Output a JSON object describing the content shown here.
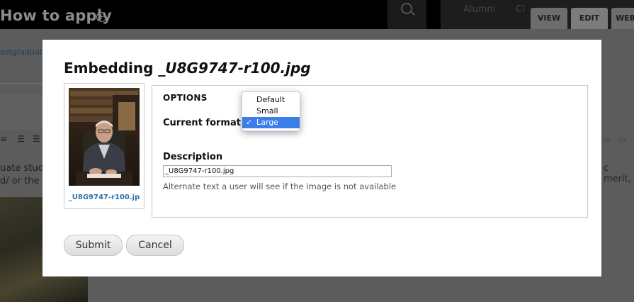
{
  "background": {
    "page_title": "How to apply",
    "nav": {
      "alumni": "Alumni",
      "more": "Cl"
    },
    "tabs": {
      "view": "VIEW",
      "edit": "EDIT",
      "web": "WEB"
    },
    "breadcrumb_link": "ostgraduate",
    "body_text_line1": "uate study",
    "body_text_line2": "d/ or the a",
    "body_text_right": "c merit,"
  },
  "dialog": {
    "title_prefix": "Embedding ",
    "title_filename": "_U8G9747-r100.jpg",
    "thumbnail_caption": "_U8G9747-r100.jp",
    "options_legend": "OPTIONS",
    "format_label": "Current format is",
    "format_options": [
      "Default",
      "Small",
      "Large"
    ],
    "format_selected": "Large",
    "description_label": "Description",
    "description_value": "_U8G9747-r100.jpg",
    "description_help": "Alternate text a user will see if the image is not available",
    "submit_label": "Submit",
    "cancel_label": "Cancel"
  },
  "colors": {
    "overlay": "#5a5a5a",
    "link": "#2a6fa8",
    "selection": "#3b7de9"
  }
}
